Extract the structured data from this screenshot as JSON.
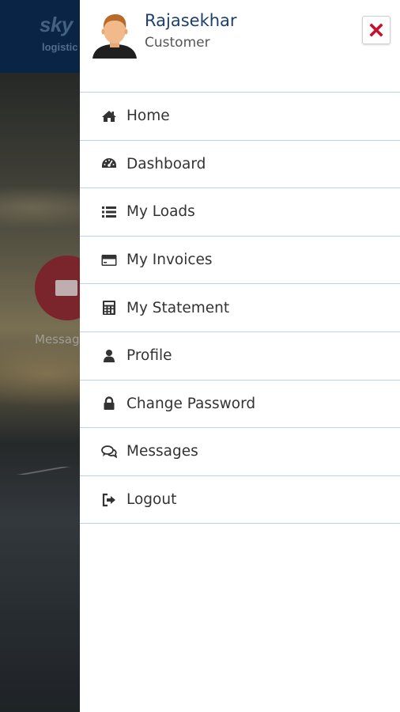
{
  "background": {
    "logo_text": "sky",
    "logo_sub": "logistic",
    "message_label": "Messag"
  },
  "drawer": {
    "user": {
      "name": "Rajasekhar",
      "role": "Customer",
      "avatar_icon": "user-avatar-icon"
    },
    "close_icon": "close-icon",
    "accent_color": "#1d3f6e",
    "close_color": "#c8102e",
    "menu": [
      {
        "label": "Home",
        "icon": "home-icon"
      },
      {
        "label": "Dashboard",
        "icon": "dashboard-icon"
      },
      {
        "label": "My Loads",
        "icon": "list-icon"
      },
      {
        "label": "My Invoices",
        "icon": "credit-card-icon"
      },
      {
        "label": "My Statement",
        "icon": "calculator-icon"
      },
      {
        "label": "Profile",
        "icon": "user-icon"
      },
      {
        "label": "Change Password",
        "icon": "lock-icon"
      },
      {
        "label": "Messages",
        "icon": "comments-icon"
      },
      {
        "label": "Logout",
        "icon": "logout-icon"
      }
    ]
  }
}
